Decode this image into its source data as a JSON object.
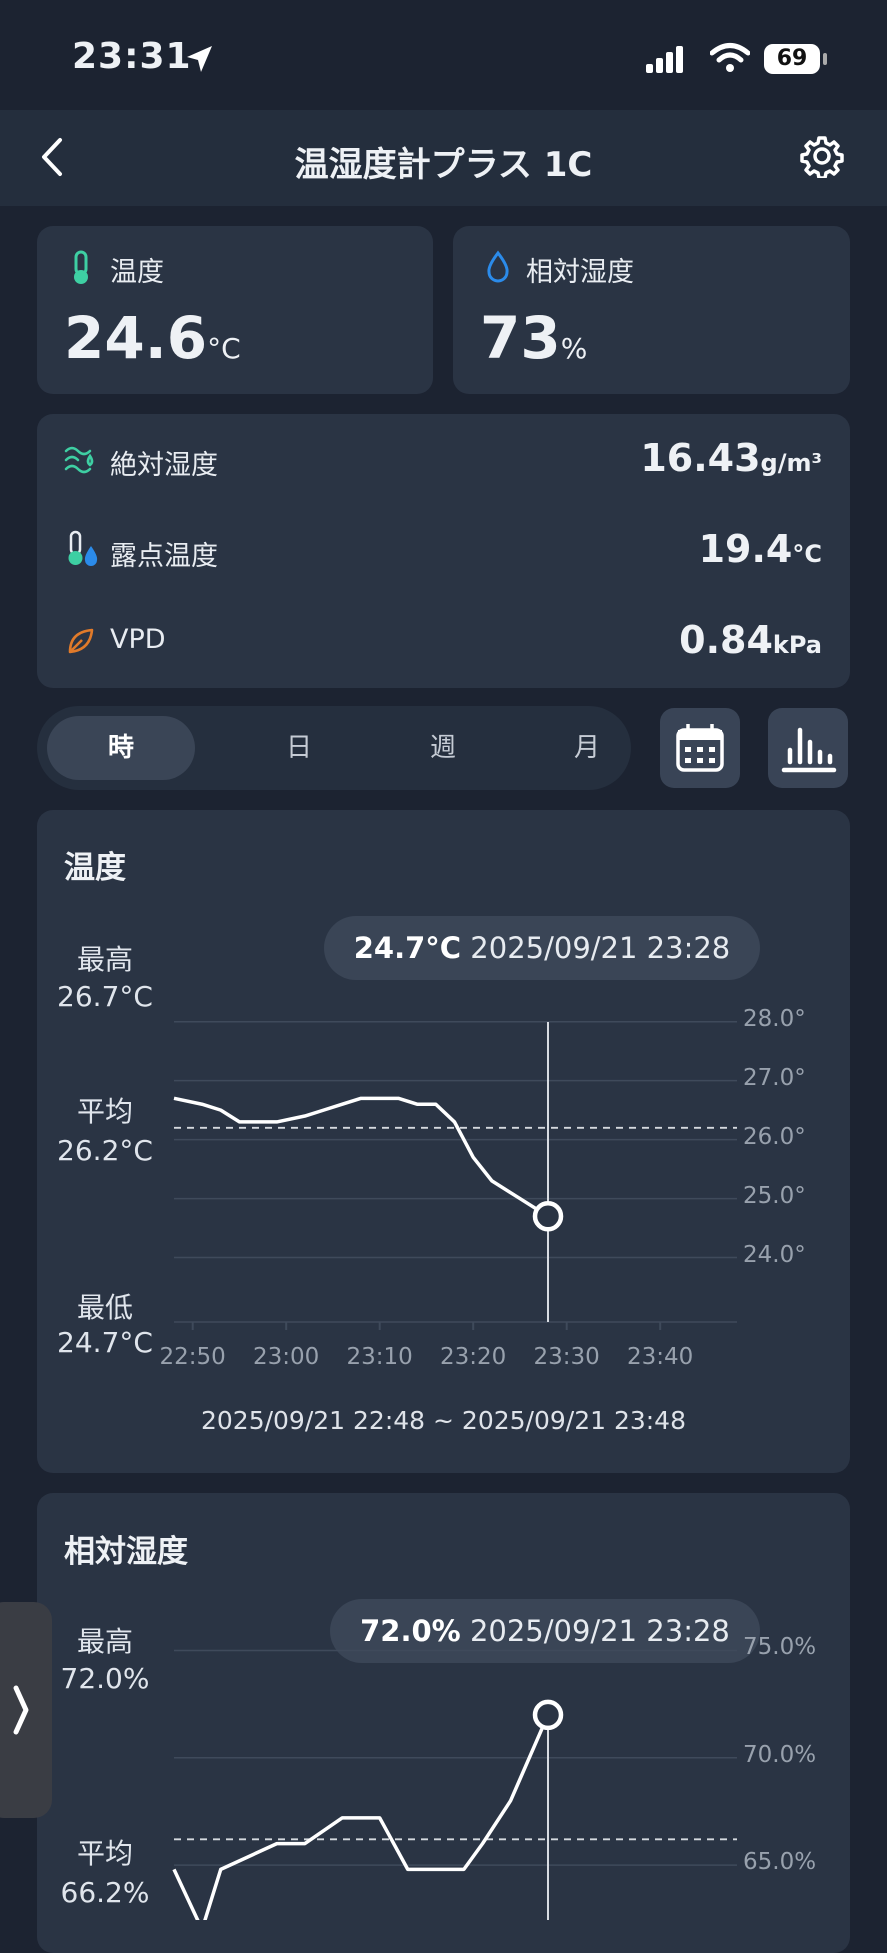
{
  "status_bar": {
    "time": "23:31",
    "battery": "69"
  },
  "header": {
    "title": "温湿度計プラス 1C"
  },
  "temperature_card": {
    "label": "温度",
    "value": "24.6",
    "unit": "°C"
  },
  "humidity_card": {
    "label": "相対湿度",
    "value": "73",
    "unit": "%"
  },
  "metrics": [
    {
      "label": "絶対湿度",
      "value": "16.43",
      "unit": "g/m³"
    },
    {
      "label": "露点温度",
      "value": "19.4",
      "unit": "°C"
    },
    {
      "label": "VPD",
      "value": "0.84",
      "unit": "kPa"
    }
  ],
  "period_tabs": [
    "時",
    "日",
    "週",
    "月"
  ],
  "active_tab": "時",
  "temp_chart": {
    "title": "温度",
    "max_label": "最高",
    "max_value": "26.7°C",
    "avg_label": "平均",
    "avg_value": "26.2°C",
    "min_label": "最低",
    "min_value": "24.7°C",
    "tooltip_value": "24.7°C",
    "tooltip_time": "2025/09/21 23:28",
    "range": "2025/09/21 22:48 ~ 2025/09/21 23:48",
    "x_ticks": [
      "22:50",
      "23:00",
      "23:10",
      "23:20",
      "23:30",
      "23:40"
    ],
    "y_ticks": [
      "28.0°",
      "27.0°",
      "26.0°",
      "25.0°",
      "24.0°"
    ]
  },
  "hum_chart": {
    "title": "相対湿度",
    "max_label": "最高",
    "max_value": "72.0%",
    "avg_label": "平均",
    "avg_value": "66.2%",
    "tooltip_value": "72.0%",
    "tooltip_time": "2025/09/21 23:28",
    "y_ticks": [
      "75.0%",
      "70.0%",
      "65.0%"
    ]
  },
  "chart_data": [
    {
      "type": "line",
      "title": "温度",
      "ylim": [
        23.5,
        28.3
      ],
      "yticks": [
        28,
        27,
        26,
        25,
        24
      ],
      "x": [
        "22:48",
        "22:51",
        "22:53",
        "22:55",
        "22:59",
        "23:02",
        "23:04",
        "23:06",
        "23:08",
        "23:12",
        "23:14",
        "23:16",
        "23:18",
        "23:20",
        "23:22",
        "23:25",
        "23:28"
      ],
      "values": [
        26.7,
        26.6,
        26.5,
        26.3,
        26.3,
        26.4,
        26.5,
        26.6,
        26.7,
        26.7,
        26.6,
        26.6,
        26.3,
        25.7,
        25.3,
        25.0,
        24.7
      ],
      "average": 26.2,
      "highlight": {
        "x": "23:28",
        "y": 24.7
      }
    },
    {
      "type": "line",
      "title": "相対湿度",
      "ylim": [
        63,
        76
      ],
      "yticks": [
        75,
        70,
        65
      ],
      "x": [
        "22:48",
        "22:51",
        "22:53",
        "22:59",
        "23:02",
        "23:06",
        "23:10",
        "23:13",
        "23:19",
        "23:21",
        "23:24",
        "23:28"
      ],
      "values": [
        64.8,
        62.0,
        64.8,
        66.0,
        66.0,
        67.2,
        67.2,
        64.8,
        64.8,
        66.0,
        68.0,
        72.0
      ],
      "average": 66.2,
      "highlight": {
        "x": "23:28",
        "y": 72.0
      }
    }
  ]
}
